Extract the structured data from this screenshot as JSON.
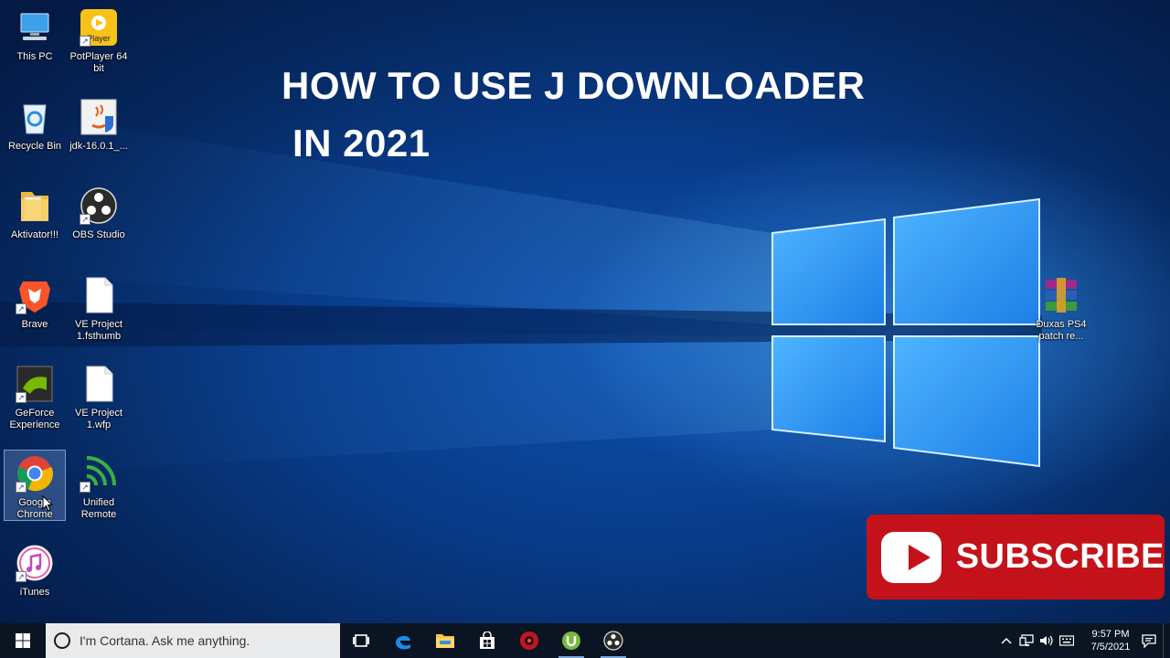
{
  "title": {
    "line1": "HOW TO USE J DOWNLOADER",
    "line2": "IN 2021"
  },
  "desktop_icons": [
    {
      "label": "This PC",
      "icon": "this-pc-icon"
    },
    {
      "label": "PotPlayer 64 bit",
      "icon": "potplayer-icon",
      "badge": "Player"
    },
    {
      "label": "Recycle Bin",
      "icon": "recycle-bin-icon"
    },
    {
      "label": "jdk-16.0.1_...",
      "icon": "java-installer-icon"
    },
    {
      "label": "Aktivator!!!",
      "icon": "folder-icon"
    },
    {
      "label": "OBS Studio",
      "icon": "obs-icon"
    },
    {
      "label": "Brave",
      "icon": "brave-icon"
    },
    {
      "label": "VE Project 1.fsthumb",
      "icon": "file-icon"
    },
    {
      "label": "GeForce Experience",
      "icon": "geforce-icon"
    },
    {
      "label": "VE Project 1.wfp",
      "icon": "file-icon"
    },
    {
      "label": "Google Chrome",
      "icon": "chrome-icon"
    },
    {
      "label": "Unified Remote",
      "icon": "unified-remote-icon"
    },
    {
      "label": "iTunes",
      "icon": "itunes-icon"
    },
    {
      "label": "Duxas PS4 patch re...",
      "icon": "winrar-icon"
    }
  ],
  "subscribe": {
    "label": "SUBSCRIBE"
  },
  "taskbar": {
    "search_placeholder": "I'm Cortana. Ask me anything.",
    "pinned": [
      "task-view-icon",
      "edge-icon",
      "file-explorer-icon",
      "store-icon",
      "red-app-icon",
      "utorrent-icon",
      "obs-icon"
    ],
    "clock_time": "9:57 PM",
    "clock_date": "7/5/2021"
  },
  "colors": {
    "subscribe_red": "#c4121a",
    "taskbar": "#0b1422",
    "wallpaper_blue": "#0c4fae"
  }
}
